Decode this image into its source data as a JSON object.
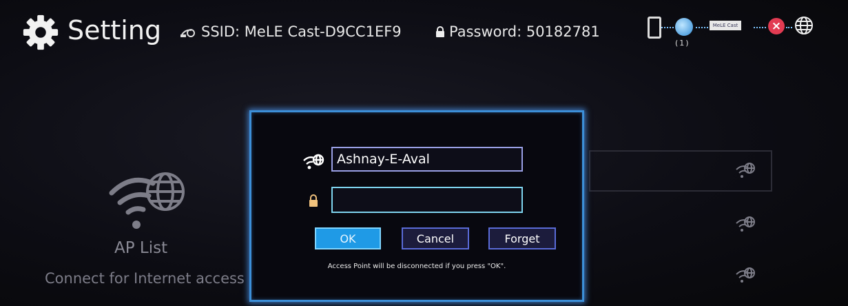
{
  "header": {
    "title": "Setting",
    "ssid_text": "SSID: MeLE Cast-D9CC1EF9",
    "password_text": "Password: 50182781"
  },
  "status_bar": {
    "connected_count": "(1)",
    "dongle_label": "MeLE Cast"
  },
  "side_panel": {
    "label": "AP List",
    "description": "Connect for Internet access"
  },
  "dialog": {
    "ssid_value": "Ashnay-E-Aval",
    "password_value": "",
    "ok_label": "OK",
    "cancel_label": "Cancel",
    "forget_label": "Forget",
    "note": "Access Point will be disconnected if you press \"OK\"."
  },
  "colors": {
    "dialog_border": "#3c8fd8",
    "ok_button": "#1f9ae6",
    "disconnect": "#e23b52"
  }
}
